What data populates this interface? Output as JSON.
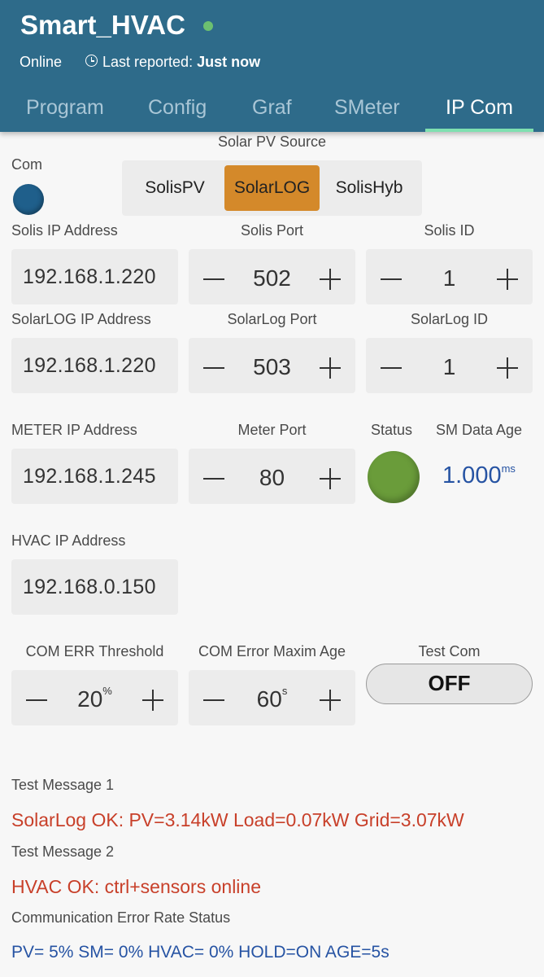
{
  "header": {
    "title": "Smart_HVAC",
    "status": "Online",
    "last_reported_prefix": "Last reported:",
    "last_reported_value": "Just now",
    "status_dot_color": "#6cc070"
  },
  "tabs": [
    "Program",
    "Config",
    "Graf",
    "SMeter",
    "IP Com"
  ],
  "active_tab": "IP Com",
  "com": {
    "label": "Com"
  },
  "solar_source": {
    "label": "Solar PV Source",
    "options": [
      "SolisPV",
      "SolarLOG",
      "SolisHyb"
    ],
    "selected": "SolarLOG"
  },
  "solis": {
    "ip_label": "Solis IP Address",
    "ip": "192.168.1.220",
    "port_label": "Solis Port",
    "port": "502",
    "id_label": "Solis ID",
    "id": "1"
  },
  "solarlog": {
    "ip_label": "SolarLOG  IP Address",
    "ip": "192.168.1.220",
    "port_label": "SolarLog  Port",
    "port": "503",
    "id_label": "SolarLog ID",
    "id": "1"
  },
  "meter": {
    "ip_label": "METER  IP Address",
    "ip": "192.168.1.245",
    "port_label": "Meter Port",
    "port": "80",
    "status_label": "Status",
    "status_color": "#6a9c3a",
    "age_label": "SM Data Age",
    "age_value": "1.000",
    "age_unit": "ms"
  },
  "hvac": {
    "ip_label": "HVAC   IP Address",
    "ip": "192.168.0.150"
  },
  "com_err": {
    "threshold_label": "COM ERR Threshold",
    "threshold_value": "20",
    "threshold_unit": "%",
    "max_age_label": "COM  Error Maxim Age",
    "max_age_value": "60",
    "max_age_unit": "s",
    "test_label": "Test Com",
    "test_value": "OFF"
  },
  "messages": {
    "msg1_label": "Test Message 1",
    "msg1": "SolarLog OK: PV=3.14kW Load=0.07kW Grid=3.07kW",
    "msg2_label": "Test Message 2",
    "msg2": "HVAC OK: ctrl+sensors online",
    "rate_label": "Communication Error Rate Status",
    "rate": "PV= 5% SM= 0% HVAC= 0% HOLD=ON AGE=5s"
  },
  "colors": {
    "header_bg": "#2e6b8a",
    "selected_segment": "#d4892a",
    "message_red": "#c8402a",
    "message_blue": "#2653a3"
  }
}
